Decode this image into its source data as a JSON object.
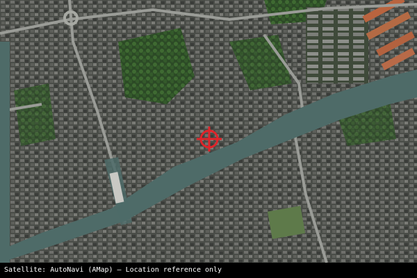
{
  "map": {
    "type": "satellite",
    "marker": {
      "icon": "crosshair-target-icon",
      "color": "#e0242a"
    }
  },
  "footer": {
    "attribution": "Satellite: AutoNavi (AMap) – Location reference only"
  }
}
